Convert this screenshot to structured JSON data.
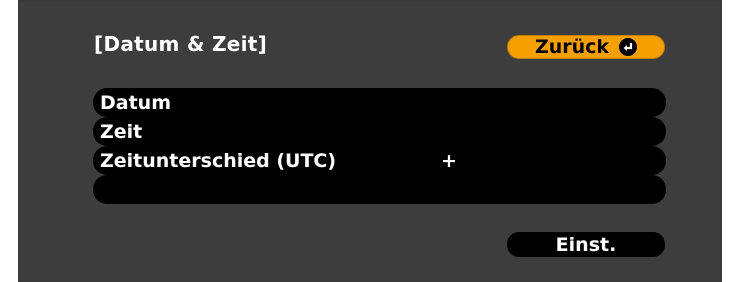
{
  "dialog": {
    "title": "[Datum & Zeit]",
    "back_label": "Zurück",
    "back_icon": "enter-icon"
  },
  "menu": {
    "items": [
      {
        "label": "Datum",
        "value": ""
      },
      {
        "label": "Zeit",
        "value": ""
      },
      {
        "label": "Zeitunterschied (UTC)",
        "value": "+"
      },
      {
        "label": "",
        "value": ""
      }
    ]
  },
  "footer": {
    "set_label": "Einst."
  },
  "colors": {
    "panel": "#3d3d3d",
    "accent": "#f5a000",
    "row": "#000000",
    "text": "#ffffff"
  }
}
